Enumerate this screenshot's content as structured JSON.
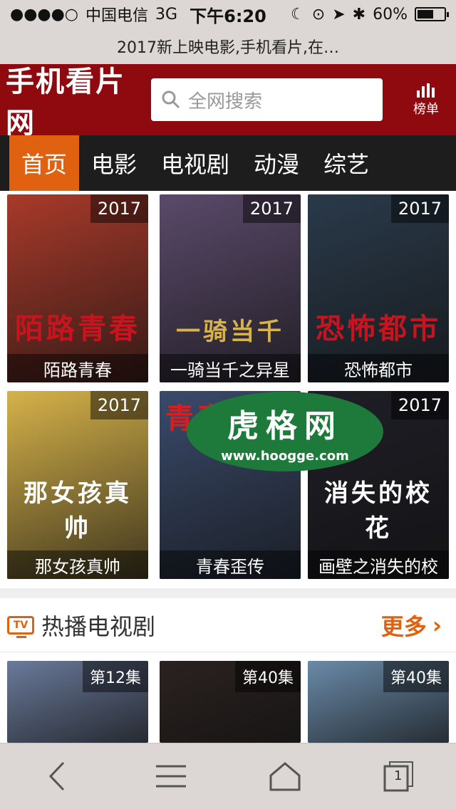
{
  "statusbar": {
    "signal": "●●●●○",
    "carrier": "中国电信",
    "network": "3G",
    "time": "下午6:20",
    "battery": "60%",
    "battery_level": 0.6
  },
  "browser": {
    "page_title": "2017新上映电影,手机看片,在…"
  },
  "header": {
    "logo": "手机看片网",
    "search_placeholder": "全网搜索",
    "rank_label": "榜单"
  },
  "nav": {
    "tabs": [
      {
        "label": "首页",
        "active": true
      },
      {
        "label": "电影",
        "active": false
      },
      {
        "label": "电视剧",
        "active": false
      },
      {
        "label": "动漫",
        "active": false
      },
      {
        "label": "综艺",
        "active": false
      }
    ]
  },
  "movies": [
    {
      "title": "陌路青春",
      "year": "2017",
      "art": "陌路青春",
      "color": "#a83a2a"
    },
    {
      "title": "一骑当千之异星",
      "year": "2017",
      "art": "一骑当千",
      "color": "#5a4a6a"
    },
    {
      "title": "恐怖都市",
      "year": "2017",
      "art": "恐怖都市",
      "color": "#2a3a4a"
    },
    {
      "title": "那女孩真帅",
      "year": "2017",
      "art": "那女孩真帅",
      "color": "#d6b24a"
    },
    {
      "title": "青春歪传",
      "year": "",
      "art": "青春",
      "color": "#3a4a6a"
    },
    {
      "title": "画壁之消失的校",
      "year": "2017",
      "art": "消失的校花",
      "color": "#1e1e26"
    }
  ],
  "tv_section": {
    "title": "热播电视剧",
    "more": "更多",
    "items": [
      {
        "episode": "第12集",
        "color": "#6a7a9a"
      },
      {
        "episode": "第40集",
        "color": "#2a2220"
      },
      {
        "episode": "第40集",
        "color": "#6a8aa8"
      }
    ]
  },
  "watermark": {
    "title": "虎格网",
    "url": "www.hoogge.com"
  },
  "toolbar": {
    "tabs_count": "1"
  }
}
